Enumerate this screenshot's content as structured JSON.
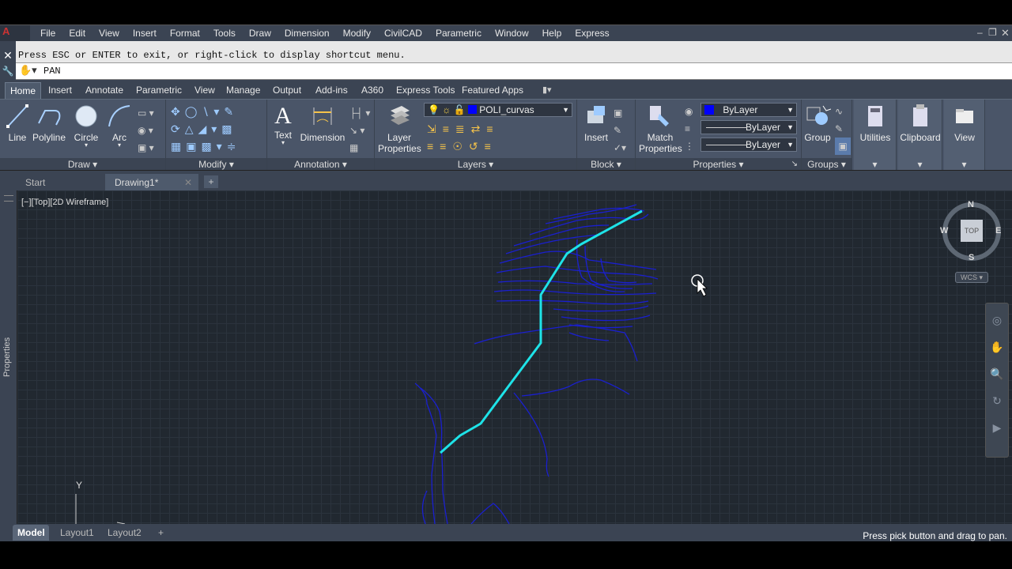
{
  "menubar": {
    "items": [
      "File",
      "Edit",
      "View",
      "Insert",
      "Format",
      "Tools",
      "Draw",
      "Dimension",
      "Modify",
      "CivilCAD",
      "Parametric",
      "Window",
      "Help",
      "Express"
    ]
  },
  "command": {
    "history": "Press ESC or ENTER to exit, or right-click to display shortcut menu.",
    "current": "PAN"
  },
  "ribbon": {
    "tabs": [
      "Home",
      "Insert",
      "Annotate",
      "Parametric",
      "View",
      "Manage",
      "Output",
      "Add-ins",
      "A360",
      "Express Tools",
      "Featured Apps"
    ],
    "draw": {
      "title": "Draw",
      "line": "Line",
      "polyline": "Polyline",
      "circle": "Circle",
      "arc": "Arc"
    },
    "modify": {
      "title": "Modify"
    },
    "annotation": {
      "title": "Annotation",
      "text": "Text",
      "dimension": "Dimension"
    },
    "layers": {
      "title": "Layers",
      "layer_properties_1": "Layer",
      "layer_properties_2": "Properties",
      "current_layer": "POLI_curvas"
    },
    "block": {
      "title": "Block",
      "insert": "Insert"
    },
    "properties": {
      "title": "Properties",
      "match_1": "Match",
      "match_2": "Properties",
      "color": "ByLayer",
      "linetype": "ByLayer",
      "lineweight": "ByLayer"
    },
    "groups": {
      "title": "Groups",
      "group": "Group"
    },
    "utilities": "Utilities",
    "clipboard": "Clipboard",
    "view": "View"
  },
  "filetabs": [
    "Start",
    "Drawing1*"
  ],
  "viewport": {
    "label": "[−][Top][2D Wireframe]",
    "palette": "Properties",
    "compass": {
      "n": "N",
      "s": "S",
      "e": "E",
      "w": "W",
      "top": "TOP",
      "wcs": "WCS"
    },
    "ucs_y": "Y"
  },
  "layouttabs": [
    "Model",
    "Layout1",
    "Layout2"
  ],
  "status": {
    "prompt": "Press pick button and drag to pan."
  },
  "colors": {
    "contour": "#1a1fd0",
    "polyline": "#1ee3e8",
    "background": "#212830"
  }
}
